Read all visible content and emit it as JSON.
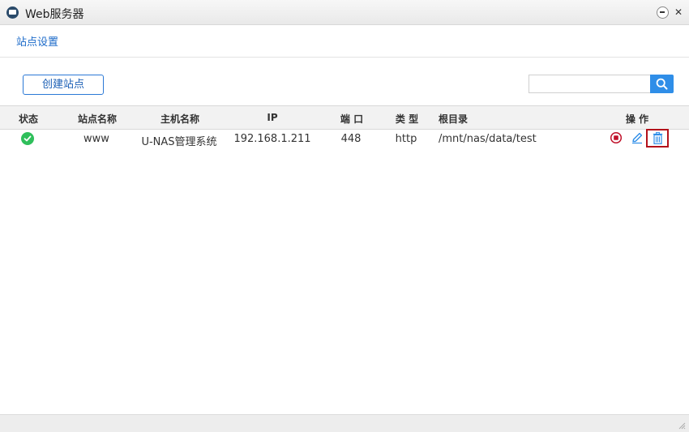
{
  "window": {
    "title": "Web服务器",
    "icon": "web-server-icon"
  },
  "tabs": [
    {
      "label": "站点设置"
    }
  ],
  "toolbar": {
    "create_label": "创建站点",
    "search_value": "",
    "search_icon": "search-icon",
    "accent": "#2f8ee8"
  },
  "table": {
    "headers": [
      "状态",
      "站点名称",
      "主机名称",
      "IP",
      "端 口",
      "类 型",
      "根目录",
      "操 作"
    ],
    "rows": [
      {
        "status_icon": "check-circle-icon",
        "site_name": "www",
        "host_name": "U-NAS管理系统",
        "ip": "192.168.1.211",
        "port": "448",
        "type": "http",
        "root": "/mnt/nas/data/test",
        "actions": [
          "stop-icon",
          "edit-icon",
          "trash-icon"
        ]
      }
    ]
  },
  "colors": {
    "status_ok": "#2fbf5b",
    "highlight": "#b3111b",
    "link": "#1b6ac9"
  }
}
